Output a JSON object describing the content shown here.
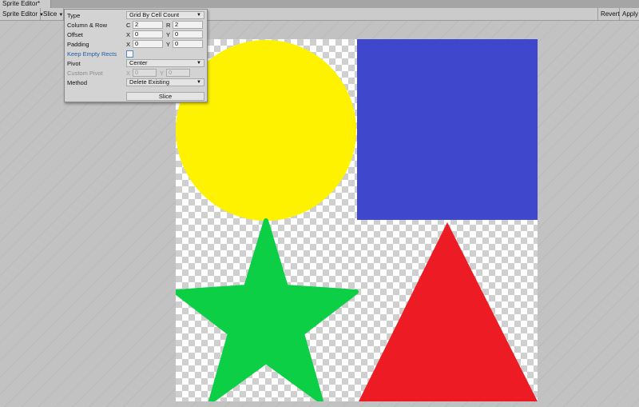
{
  "window": {
    "tab_title": "Sprite Editor*"
  },
  "toolbar": {
    "sprite_editor_label": "Sprite Editor",
    "slice_label": "Slice",
    "revert_label": "Revert",
    "apply_label": "Apply"
  },
  "slice_panel": {
    "type_label": "Type",
    "type_value": "Grid By Cell Count",
    "column_row_label": "Column & Row",
    "columns_axis": "C",
    "columns_value": "2",
    "rows_axis": "R",
    "rows_value": "2",
    "offset_label": "Offset",
    "offset_x_axis": "X",
    "offset_x": "0",
    "offset_y_axis": "Y",
    "offset_y": "0",
    "padding_label": "Padding",
    "padding_x_axis": "X",
    "padding_x": "0",
    "padding_y_axis": "Y",
    "padding_y": "0",
    "keep_empty_rects_label": "Keep Empty Rects",
    "keep_empty_rects_checked": false,
    "pivot_label": "Pivot",
    "pivot_value": "Center",
    "custom_pivot_label": "Custom Pivot",
    "custom_pivot_x_axis": "X",
    "custom_pivot_x": "0",
    "custom_pivot_y_axis": "Y",
    "custom_pivot_y": "0",
    "method_label": "Method",
    "method_value": "Delete Existing",
    "slice_button_label": "Slice"
  },
  "sprite": {
    "shapes": [
      {
        "name": "circle",
        "color": "#fff200"
      },
      {
        "name": "square",
        "color": "#3f48cc"
      },
      {
        "name": "star",
        "color": "#0ccf45"
      },
      {
        "name": "triangle",
        "color": "#ed1c24"
      }
    ]
  }
}
